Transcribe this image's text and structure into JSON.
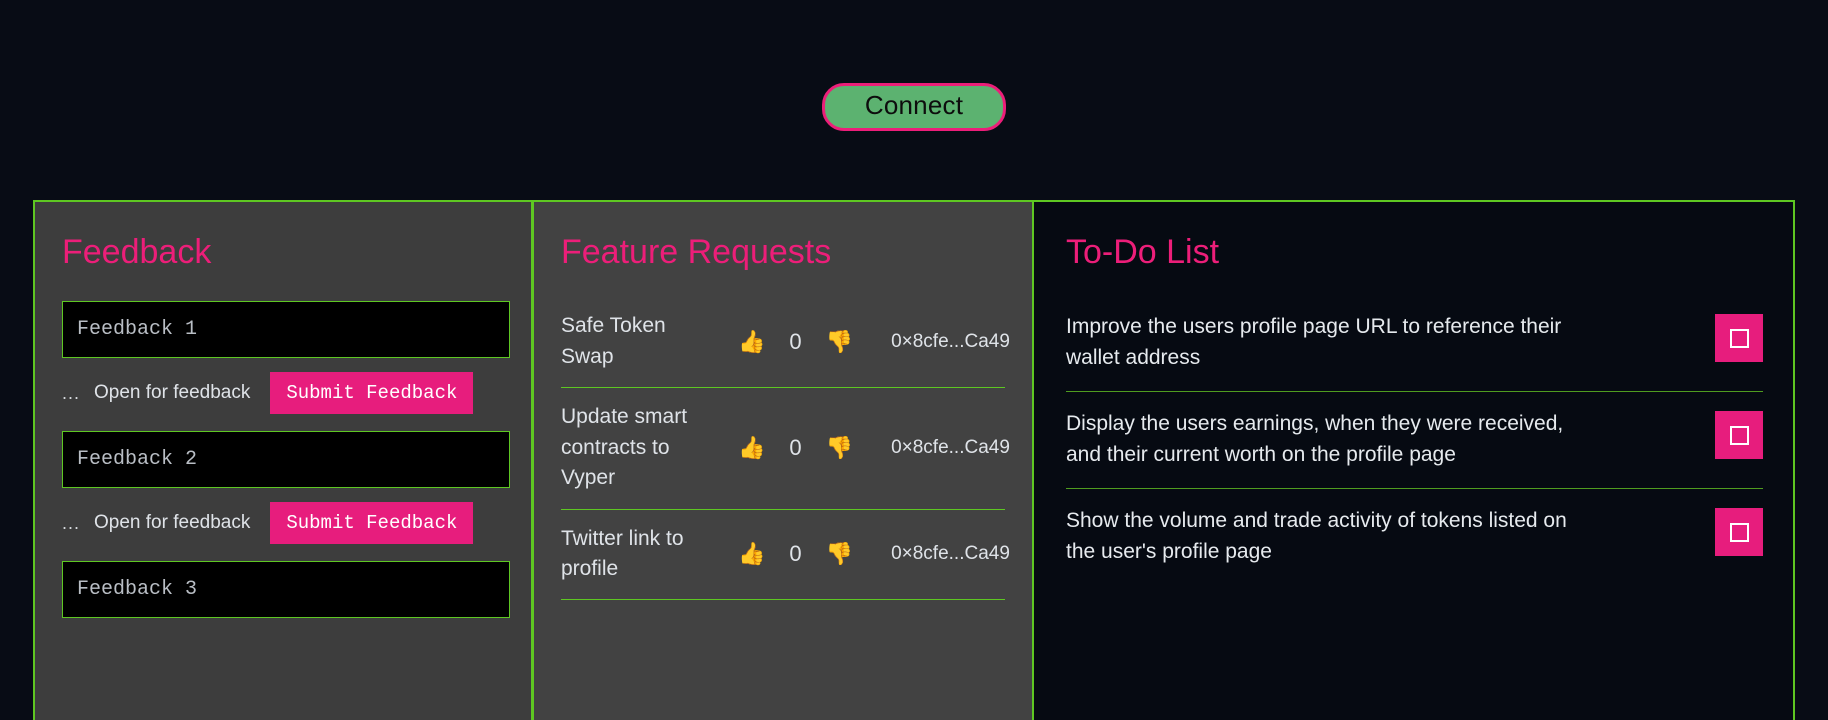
{
  "header": {
    "connect_label": "Connect",
    "connect_bg": "#5cb270",
    "connect_border": "#ec1e79"
  },
  "theme": {
    "accent_pink": "#ec1e79",
    "accent_green": "#5ec722",
    "page_bg": "#080c15",
    "panel_bg": "#3d3d3d"
  },
  "feedback": {
    "title": "Feedback",
    "items": [
      {
        "placeholder": "Feedback 1",
        "value": "",
        "dots": "...",
        "status": "Open for feedback",
        "submit_label": "Submit Feedback"
      },
      {
        "placeholder": "Feedback 2",
        "value": "",
        "dots": "...",
        "status": "Open for feedback",
        "submit_label": "Submit Feedback"
      },
      {
        "placeholder": "Feedback 3",
        "value": "",
        "dots": "...",
        "status": "Open for feedback",
        "submit_label": "Submit Feedback"
      }
    ]
  },
  "features": {
    "title": "Feature Requests",
    "thumbs_up_icon": "👍",
    "thumbs_down_icon": "👎",
    "rows": [
      {
        "name": "Safe Token Swap",
        "votes": "0",
        "address": "0×8cfe...Ca49"
      },
      {
        "name": "Update smart contracts to Vyper",
        "votes": "0",
        "address": "0×8cfe...Ca49"
      },
      {
        "name": "Twitter link to profile",
        "votes": "0",
        "address": "0×8cfe...Ca49"
      }
    ]
  },
  "todo": {
    "title": "To-Do List",
    "rows": [
      {
        "text": "Improve the users profile page URL to reference their wallet address",
        "checked": false
      },
      {
        "text": "Display the users earnings, when they were received, and their current worth on the profile page",
        "checked": false
      },
      {
        "text": "Show the volume and trade activity of tokens listed on the user's profile page",
        "checked": false
      }
    ]
  }
}
